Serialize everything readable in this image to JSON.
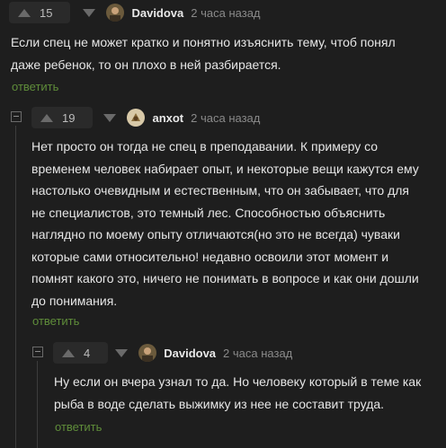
{
  "comments": [
    {
      "votes": "15",
      "author": "Davidova",
      "time": "2 часа назад",
      "text_lines": [
        "Если спец не может кратко и понятно изъяснить тему, чтоб понял",
        "даже ребенок, то он плохо в ней разбирается."
      ],
      "reply_label": "ответить"
    },
    {
      "votes": "19",
      "author": "anxot",
      "time": "2 часа назад",
      "text_lines": [
        "Нет просто он тогда не спец в преподавании. К примеру со",
        "временем человек набирает опыт, и некоторые вещи кажутся ему",
        "настолько очевидным и естественным, что он забывает, что для",
        "не специалистов, это темный лес. Способностью объяснить",
        "наглядно по моему опыту отличаются(но это не всегда) чуваки",
        "которые сами относительно! недавно освоили этот момент и",
        "помнят какого это, ничего не понимать в вопросе и как они дошли",
        "до понимания."
      ],
      "reply_label": "ответить"
    },
    {
      "votes": "4",
      "author": "Davidova",
      "time": "2 часа назад",
      "text_lines": [
        "Ну если он вчера узнал то да. Но человеку который в теме как",
        "рыба в воде сделать выжимку из нее не составит труда."
      ],
      "reply_label": "ответить"
    }
  ],
  "icons": {
    "upvote": "triangle-up-icon",
    "downvote": "triangle-down-icon",
    "collapse": "minus-square-icon"
  }
}
